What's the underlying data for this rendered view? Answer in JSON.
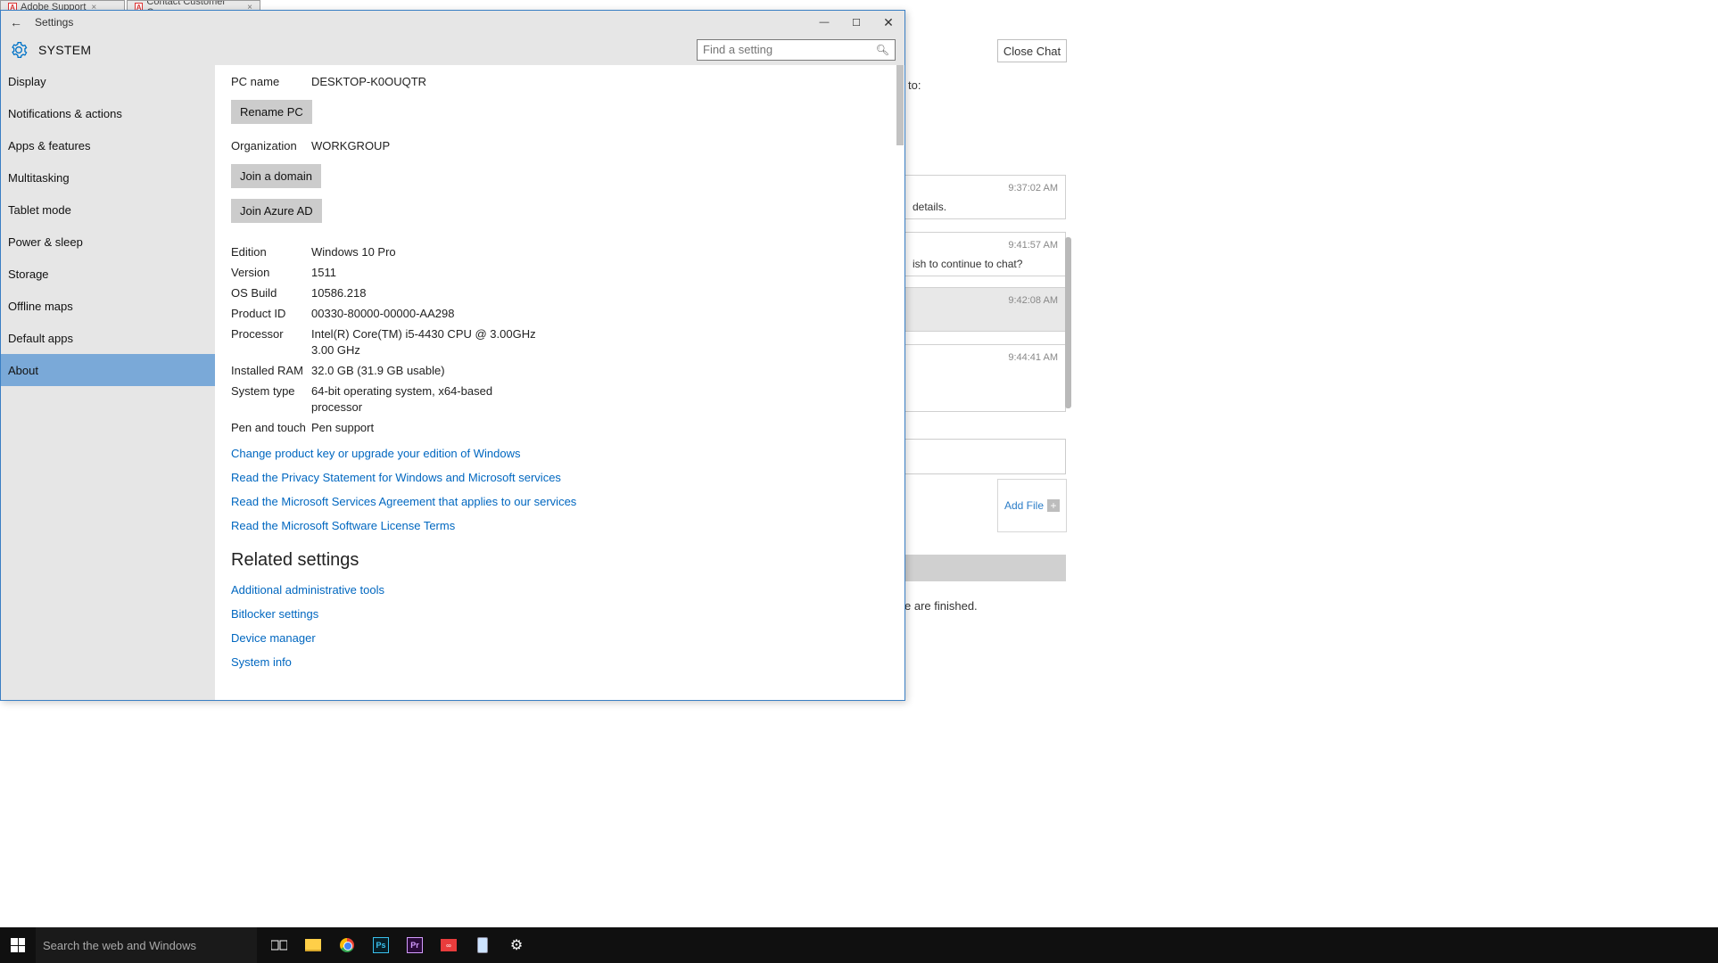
{
  "browser": {
    "tabs": [
      {
        "label": "Adobe Support"
      },
      {
        "label": "Contact Customer Care"
      }
    ]
  },
  "settings": {
    "titlebar": {
      "title": "Settings"
    },
    "header": {
      "title": "SYSTEM"
    },
    "search": {
      "placeholder": "Find a setting"
    },
    "sidebar": {
      "items": [
        "Display",
        "Notifications & actions",
        "Apps & features",
        "Multitasking",
        "Tablet mode",
        "Power & sleep",
        "Storage",
        "Offline maps",
        "Default apps",
        "About"
      ],
      "activeIndex": 9
    },
    "about": {
      "pc_name_label": "PC name",
      "pc_name": "DESKTOP-K0OUQTR",
      "rename_btn": "Rename PC",
      "org_label": "Organization",
      "org": "WORKGROUP",
      "join_domain_btn": "Join a domain",
      "join_azure_btn": "Join Azure AD",
      "rows": [
        {
          "k": "Edition",
          "v": "Windows 10 Pro"
        },
        {
          "k": "Version",
          "v": "1511"
        },
        {
          "k": "OS Build",
          "v": "10586.218"
        },
        {
          "k": "Product ID",
          "v": "00330-80000-00000-AA298"
        },
        {
          "k": "Processor",
          "v": "Intel(R) Core(TM) i5-4430 CPU @ 3.00GHz   3.00 GHz"
        },
        {
          "k": "Installed RAM",
          "v": "32.0 GB (31.9 GB usable)"
        },
        {
          "k": "System type",
          "v": "64-bit operating system, x64-based processor"
        },
        {
          "k": "Pen and touch",
          "v": "Pen support"
        }
      ],
      "links": [
        "Change product key or upgrade your edition of Windows",
        "Read the Privacy Statement for Windows and Microsoft services",
        "Read the Microsoft Services Agreement that applies to our services",
        "Read the Microsoft Software License Terms"
      ],
      "related_heading": "Related settings",
      "related": [
        "Additional administrative tools",
        "Bitlocker settings",
        "Device manager",
        "System info"
      ]
    }
  },
  "chat": {
    "close_btn": "Close Chat",
    "to_fragment": "to:",
    "messages": [
      {
        "ts": "9:37:02 AM",
        "text": "details."
      },
      {
        "ts": "9:41:57 AM",
        "text": "ish to continue to chat?"
      },
      {
        "ts": "9:42:08 AM",
        "text": ""
      },
      {
        "ts": "9:44:41 AM",
        "text": ""
      }
    ],
    "add_file": "Add File",
    "finished_fragment": "e are finished."
  },
  "taskbar": {
    "search_placeholder": "Search the web and Windows"
  }
}
